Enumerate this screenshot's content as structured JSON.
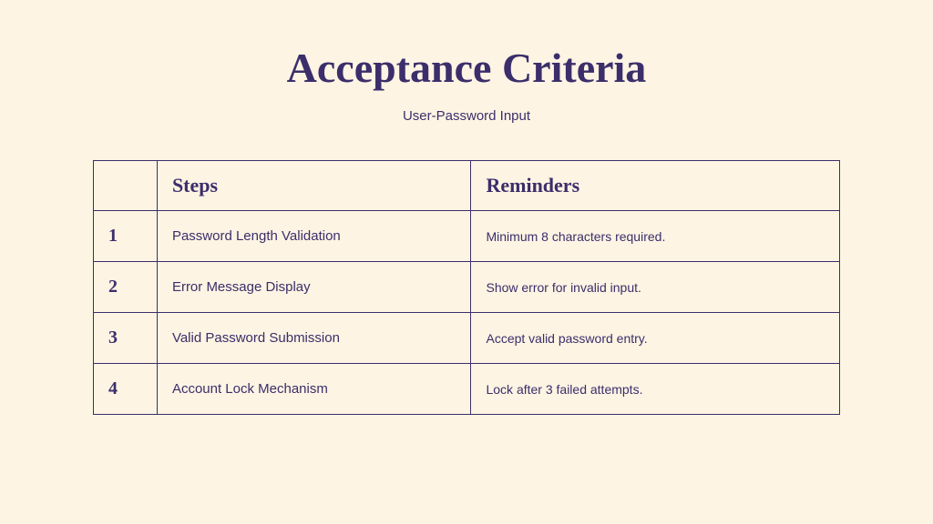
{
  "title": "Acceptance Criteria",
  "subtitle": "User-Password Input",
  "table": {
    "headers": {
      "num": "",
      "steps": "Steps",
      "reminders": "Reminders"
    },
    "rows": [
      {
        "num": "1",
        "step": "Password Length Validation",
        "reminder": "Minimum 8 characters required."
      },
      {
        "num": "2",
        "step": "Error Message Display",
        "reminder": "Show error for invalid input."
      },
      {
        "num": "3",
        "step": "Valid Password Submission",
        "reminder": "Accept valid password entry."
      },
      {
        "num": "4",
        "step": "Account Lock Mechanism",
        "reminder": "Lock after 3 failed attempts."
      }
    ]
  }
}
